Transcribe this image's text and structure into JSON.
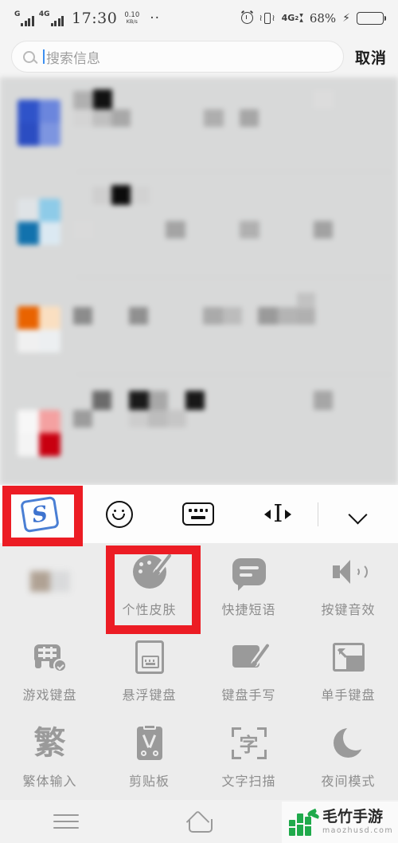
{
  "status_bar": {
    "signal_1_label": "G",
    "signal_2_label": "4G",
    "time": "17:30",
    "net_speed_value": "0.10",
    "net_speed_unit": "KB/s",
    "overflow_dots": "··",
    "alarm_icon": "alarm-clock-icon",
    "vibrate_icon": "vibrate-icon",
    "data_label": "4G",
    "data_sub": "2",
    "battery_percent": "68%",
    "charging_icon": "lightning-bolt-icon",
    "battery_level": 68
  },
  "search": {
    "icon": "search-icon",
    "placeholder": "搜索信息",
    "value": "",
    "cancel_label": "取消"
  },
  "content": {
    "description": "blurred-message-list"
  },
  "keyboard_toolbar": {
    "items": [
      {
        "name": "sogou-logo",
        "icon": "sogou-logo-icon",
        "letter": "S",
        "highlighted": true
      },
      {
        "name": "emoji",
        "icon": "smiley-face-icon",
        "highlighted": false
      },
      {
        "name": "keyboard-switch",
        "icon": "keyboard-icon",
        "highlighted": false
      },
      {
        "name": "cursor-move",
        "icon": "cursor-move-icon",
        "highlighted": false
      },
      {
        "name": "collapse",
        "icon": "chevron-down-icon",
        "highlighted": false
      }
    ]
  },
  "function_grid": {
    "rows": [
      [
        {
          "label": "",
          "icon": "blurred-icon",
          "blurred": true,
          "highlighted": false
        },
        {
          "label": "个性皮肤",
          "icon": "palette-brush-icon",
          "blurred": false,
          "highlighted": true
        },
        {
          "label": "快捷短语",
          "icon": "speech-bubble-icon",
          "blurred": false,
          "highlighted": false
        },
        {
          "label": "按键音效",
          "icon": "speaker-icon",
          "blurred": false,
          "highlighted": false
        }
      ],
      [
        {
          "label": "游戏键盘",
          "icon": "gamepad-icon",
          "blurred": false,
          "highlighted": false
        },
        {
          "label": "悬浮键盘",
          "icon": "floating-keyboard-icon",
          "blurred": false,
          "highlighted": false
        },
        {
          "label": "键盘手写",
          "icon": "handwriting-icon",
          "blurred": false,
          "highlighted": false
        },
        {
          "label": "单手键盘",
          "icon": "one-hand-keyboard-icon",
          "blurred": false,
          "highlighted": false
        }
      ],
      [
        {
          "label": "繁体输入",
          "icon": "fanti-character-icon",
          "glyph": "繁",
          "blurred": false,
          "highlighted": false
        },
        {
          "label": "剪贴板",
          "icon": "clipboard-scissors-icon",
          "blurred": false,
          "highlighted": false
        },
        {
          "label": "文字扫描",
          "icon": "text-scan-icon",
          "glyph": "字",
          "blurred": false,
          "highlighted": false
        },
        {
          "label": "夜间模式",
          "icon": "moon-icon",
          "blurred": false,
          "highlighted": false
        }
      ]
    ]
  },
  "nav_bar": {
    "menu_icon": "hamburger-menu-icon",
    "home_icon": "home-icon"
  },
  "watermark": {
    "logo_icon": "bamboo-logo-icon",
    "title": "毛竹手游",
    "url": "maozhusd.com"
  },
  "colors": {
    "highlight_red": "#ec1c24",
    "accent_blue": "#3f74cf",
    "caret_blue": "#3d8ff0",
    "icon_gray": "#9a9a9a",
    "watermark_green": "#1faa4b"
  }
}
